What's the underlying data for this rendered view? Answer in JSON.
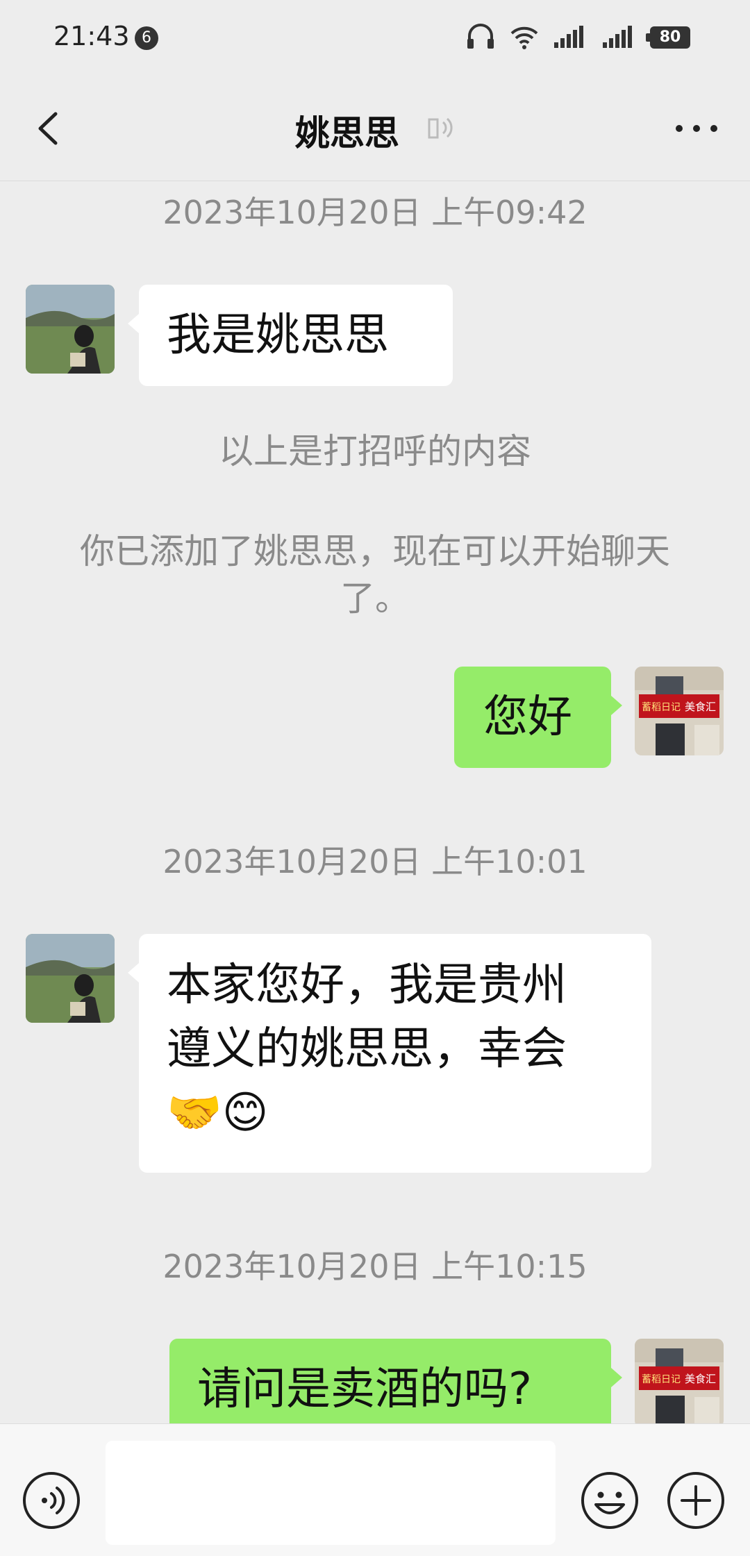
{
  "status_bar": {
    "time": "21:43",
    "notification_count": "6",
    "battery": "80",
    "icons": [
      "headset-icon",
      "wifi-icon",
      "signal-icon",
      "signal-2-icon",
      "battery-icon"
    ]
  },
  "nav": {
    "title": "姚思思",
    "back_icon": "back-arrow-icon",
    "voice_indicator_icon": "ear-speaker-icon",
    "more_icon": "more-dots-icon"
  },
  "messages": [
    {
      "type": "timestamp",
      "text": "2023年10月20日 上午09:42"
    },
    {
      "type": "incoming",
      "text": "我是姚思思"
    },
    {
      "type": "system",
      "text": "以上是打招呼的内容"
    },
    {
      "type": "system",
      "text": "你已添加了姚思思，现在可以开始聊天了。"
    },
    {
      "type": "outgoing",
      "text": "您好"
    },
    {
      "type": "timestamp",
      "text": "2023年10月20日 上午10:01"
    },
    {
      "type": "incoming",
      "lines": [
        "本家您好，我是贵州",
        "遵义的姚思思，幸会",
        "🤝😊"
      ]
    },
    {
      "type": "timestamp",
      "text": "2023年10月20日 上午10:15"
    },
    {
      "type": "outgoing",
      "text": "请问是卖酒的吗?"
    }
  ],
  "my_avatar_sign": {
    "left": "蓄稻日记",
    "right": "美食汇"
  },
  "input_bar": {
    "placeholder": "",
    "voice_icon": "voice-input-icon",
    "emoji_icon": "emoji-icon",
    "plus_icon": "plus-icon"
  },
  "colors": {
    "background": "#ededed",
    "outgoing_bubble": "#95ec69",
    "incoming_bubble": "#ffffff",
    "meta_text": "#8a8a8a"
  }
}
